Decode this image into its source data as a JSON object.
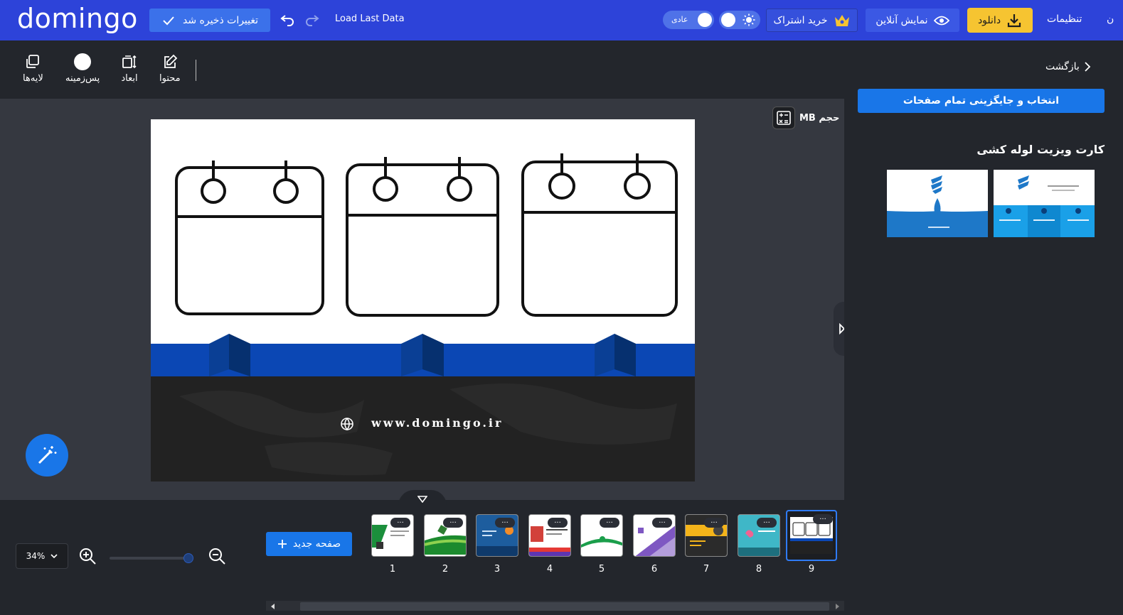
{
  "topbar": {
    "logo": "domingo",
    "save_status": "تغییرات ذخیره شد",
    "load_last": "Load Last Data",
    "mode_label": "عادی",
    "subscribe": "خرید اشتراک",
    "online_preview": "نمایش آنلاین",
    "download": "دانلود",
    "settings": "تنظیمات",
    "cut_label": "ن",
    "icons": [
      "check-icon",
      "undo-icon",
      "redo-icon",
      "sun-icon",
      "crown-icon",
      "eye-icon",
      "download-icon"
    ]
  },
  "toolbar": {
    "layers": "لایه‌ها",
    "background": "پس‌زمینه",
    "dimensions": "ابعاد",
    "content": "محتوا"
  },
  "workspace": {
    "size_label": "حجم MB",
    "canvas_url": "www.domingo.ir"
  },
  "bottom": {
    "zoom": "34%",
    "new_page": "صفحه جدید",
    "pages": [
      "1",
      "2",
      "3",
      "4",
      "5",
      "6",
      "7",
      "8",
      "9"
    ],
    "active_page": "9",
    "page_dots": "..."
  },
  "rightpanel": {
    "back": "بازگشت",
    "replace_all": "انتخاب و جایگزینی تمام صفحات",
    "template_title": "کارت ویزیت لوله کشی"
  },
  "colors": {
    "topbar": "#2d43d9",
    "accent": "#1976e8",
    "download": "#f6c431",
    "canvas_band": "#0b47b4",
    "canvas_dark": "#222222"
  }
}
